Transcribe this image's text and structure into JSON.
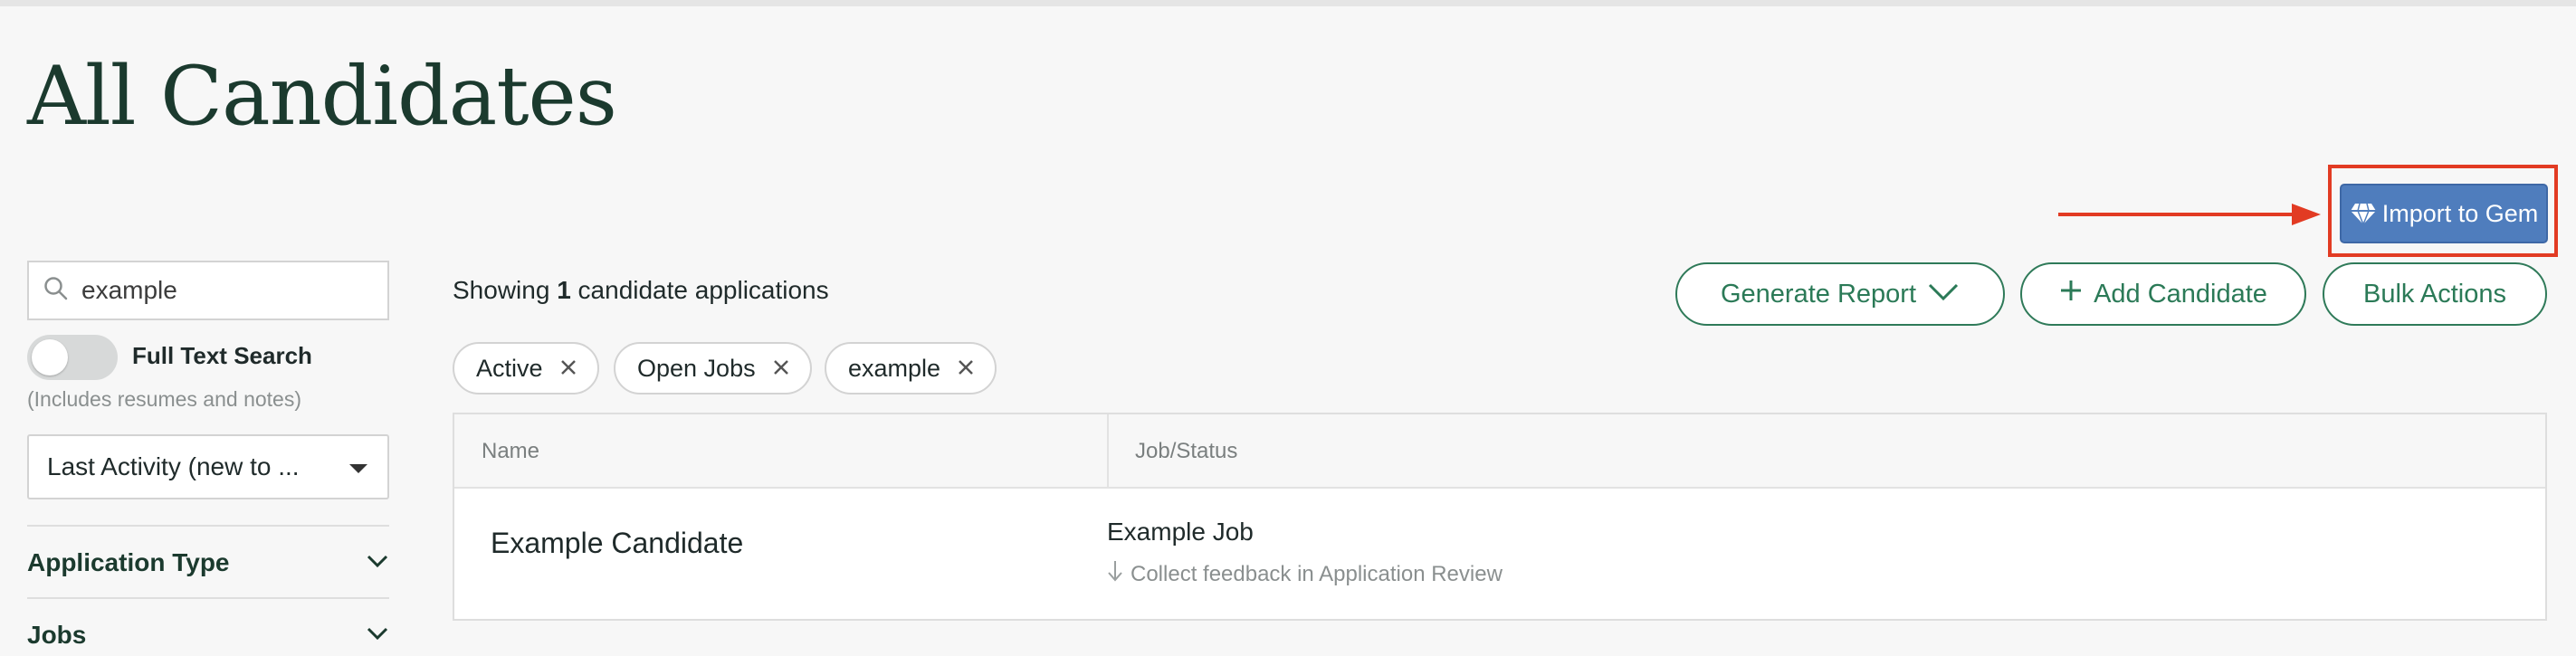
{
  "page": {
    "title": "All Candidates"
  },
  "gem": {
    "button_label": "Import to Gem",
    "button_color": "#4f7dbd",
    "highlight_color": "#e23b23"
  },
  "sidebar": {
    "search": {
      "value": "example",
      "placeholder": ""
    },
    "full_text_search": {
      "label": "Full Text Search",
      "hint": "(Includes resumes and notes)",
      "enabled": false
    },
    "sort": {
      "selected": "Last Activity (new to ..."
    },
    "filters": [
      {
        "label": "Application Type",
        "icon": "chevron-down-icon"
      },
      {
        "label": "Jobs",
        "icon": "chevron-down-icon"
      }
    ]
  },
  "results": {
    "prefix": "Showing ",
    "count": "1",
    "suffix": " candidate applications"
  },
  "active_filters": [
    {
      "label": "Active"
    },
    {
      "label": "Open Jobs"
    },
    {
      "label": "example"
    }
  ],
  "actions": {
    "generate_report": "Generate Report",
    "add_candidate": "Add Candidate",
    "bulk_actions": "Bulk Actions",
    "accent_color": "#2b7a57"
  },
  "table": {
    "columns": [
      "Name",
      "Job/Status"
    ],
    "rows": [
      {
        "name": "Example Candidate",
        "job": "Example Job",
        "status": "Collect feedback in Application Review"
      }
    ]
  }
}
